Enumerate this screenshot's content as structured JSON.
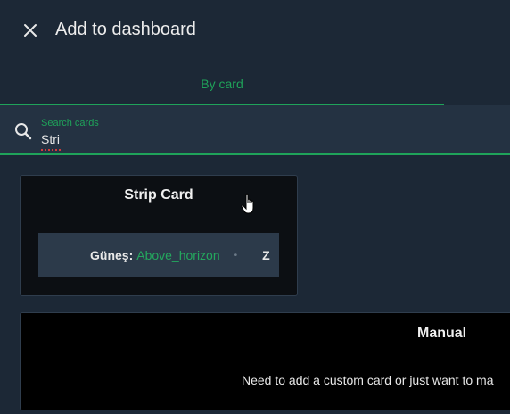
{
  "dialog": {
    "title": "Add to dashboard"
  },
  "tabs": [
    {
      "label": "By card",
      "active": true
    }
  ],
  "search": {
    "label": "Search cards",
    "value": "Stri"
  },
  "cards": {
    "strip": {
      "title": "Strip Card",
      "preview": {
        "entity_name": "Güneş:",
        "entity_value": "Above_horizon",
        "separator": "•",
        "next_entity_partial": "Z"
      }
    },
    "manual": {
      "title": "Manual",
      "description": "Need to add a custom card or just want to ma"
    }
  },
  "colors": {
    "accent": "#1fa35a",
    "background": "#1c2836",
    "search_background": "#243242",
    "card_background": "#0c0f13"
  },
  "icons": {
    "close": "close-icon",
    "search": "search-icon",
    "cursor": "hand-pointer-cursor"
  }
}
